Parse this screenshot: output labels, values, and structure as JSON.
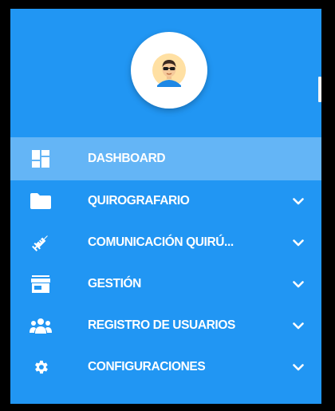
{
  "theme": {
    "sidebar_bg": "#2196f3",
    "active_bg": "#64b5f6",
    "text": "#ffffff",
    "avatar_bg": "#ffffff"
  },
  "user": {
    "avatar_icon": "user-with-sunglasses-avatar"
  },
  "menu": {
    "items": [
      {
        "label": "DASHBOARD",
        "icon": "dashboard-icon",
        "active": true,
        "expandable": false
      },
      {
        "label": "QUIROGRAFARIO",
        "icon": "folder-icon",
        "active": false,
        "expandable": true
      },
      {
        "label": "COMUNICACIÓN QUIRÚ...",
        "icon": "syringe-icon",
        "active": false,
        "expandable": true
      },
      {
        "label": "GESTIÓN",
        "icon": "store-icon",
        "active": false,
        "expandable": true
      },
      {
        "label": "REGISTRO DE USUARIOS",
        "icon": "people-icon",
        "active": false,
        "expandable": true
      },
      {
        "label": "CONFIGURACIONES",
        "icon": "gear-icon",
        "active": false,
        "expandable": true
      }
    ]
  }
}
